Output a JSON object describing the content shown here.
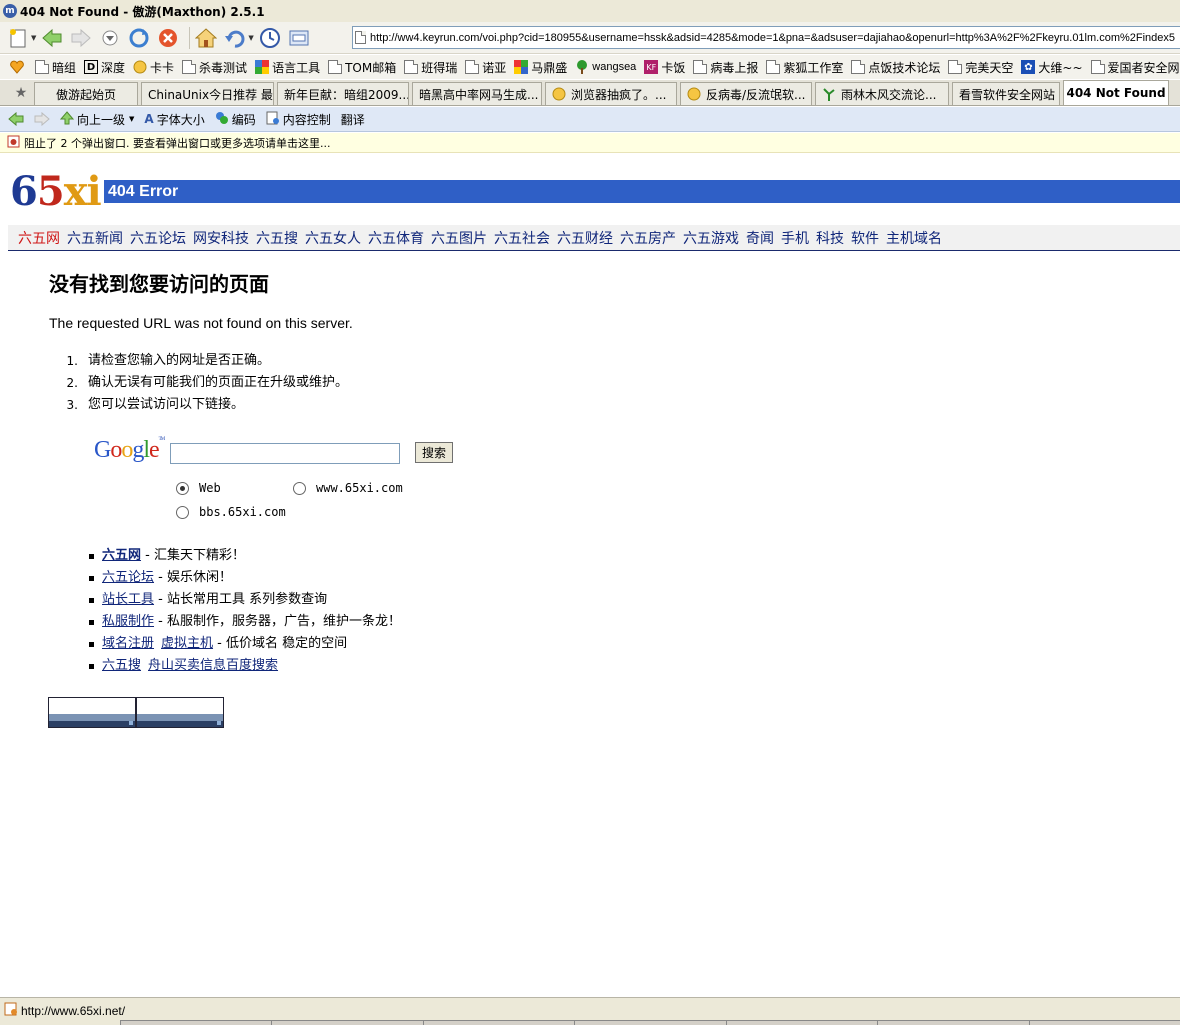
{
  "window": {
    "title": "404 Not Found - 傲游(Maxthon) 2.5.1"
  },
  "addressbar": {
    "url": "http://ww4.keyrun.com/voi.php?cid=180955&username=hssk&adsid=4285&mode=1&pna=&adsuser=dajiahao&openurl=http%3A%2F%2Fkeyru.01lm.com%2Findex5"
  },
  "favorites": [
    "暗组",
    "深度",
    "卡卡",
    "杀毒测试",
    "语言工具",
    "TOM邮箱",
    "班得瑞",
    "诺亚",
    "马鼎盛",
    "wangsea",
    "卡饭",
    "病毒上报",
    "紫狐工作室",
    "点饭技术论坛",
    "完美天空",
    "大维~~",
    "爱国者安全网"
  ],
  "tabs": [
    "傲游起始页",
    "ChinaUnix今日推荐 最...",
    "新年巨献：暗组2009...",
    "暗黑高中率网马生成...",
    "浏览器抽疯了。...",
    "反病毒/反流氓软...",
    "雨林木风交流论...",
    "看雪软件安全网站",
    "404 Not Found"
  ],
  "subbar": {
    "up": "向上一级",
    "font": "字体大小",
    "encoding": "编码",
    "content": "内容控制",
    "translate": "翻译"
  },
  "popup_notice": "阻止了 2 个弹出窗口. 要查看弹出窗口或更多选项请单击这里...",
  "page": {
    "logo": {
      "part1": "6",
      "part2": "5",
      "part3": "xi"
    },
    "error_label": "404 Error",
    "nav": [
      "六五网",
      "六五新闻",
      "六五论坛",
      "网安科技",
      "六五搜",
      "六五女人",
      "六五体育",
      "六五图片",
      "六五社会",
      "六五财经",
      "六五房产",
      "六五游戏",
      "奇闻",
      "手机",
      "科技",
      "软件",
      "主机域名"
    ],
    "heading": "没有找到您要访问的页面",
    "message": "The requested URL was not found on this server.",
    "steps": [
      {
        "num": "1.",
        "text": "请检查您输入的网址是否正确。"
      },
      {
        "num": "2.",
        "text": "确认无误有可能我们的页面正在升级或维护。"
      },
      {
        "num": "3.",
        "text": "您可以尝试访问以下链接。"
      }
    ],
    "search": {
      "logo": "Google",
      "button": "搜索",
      "options": [
        "Web",
        "www.65xi.com",
        "bbs.65xi.com"
      ]
    },
    "links": [
      {
        "a": "六五网",
        "desc": " - 汇集天下精彩！"
      },
      {
        "a": "六五论坛",
        "desc": " - 娱乐休闲！"
      },
      {
        "a": "站长工具",
        "desc": " - 站长常用工具 系列参数查询"
      },
      {
        "a": "私服制作",
        "desc": " - 私服制作，服务器，广告，维护一条龙！"
      },
      {
        "a": "域名注册",
        "a2": "虚拟主机",
        "desc": " - 低价域名 稳定的空间"
      },
      {
        "a": "六五搜",
        "a2": "舟山买卖信息百度搜索",
        "desc": ""
      }
    ]
  },
  "status": {
    "text": "http://www.65xi.net/"
  },
  "colors": {
    "accent": "#2f5fc6",
    "nav_link": "#10267a",
    "nav_active": "#d01818"
  }
}
